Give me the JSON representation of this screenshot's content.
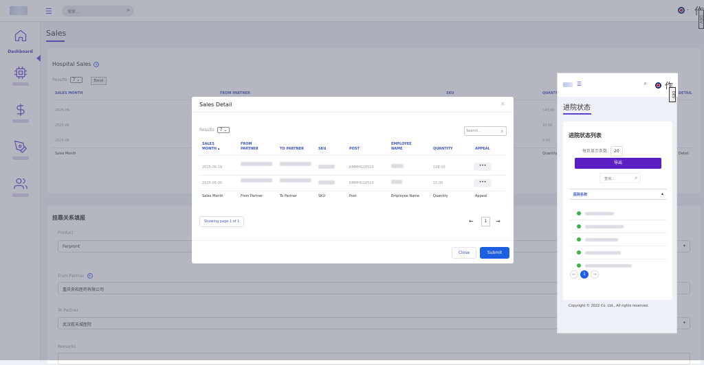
{
  "header": {
    "search_placeholder": "搜索...",
    "lang_char": "作",
    "badge": "DEV"
  },
  "sidebar": {
    "items": [
      {
        "label": "Dashboard",
        "icon": "home-icon"
      },
      {
        "label": "",
        "icon": "cpu-icon"
      },
      {
        "label": "",
        "icon": "dollar-icon"
      },
      {
        "label": "",
        "icon": "pen-tool-icon"
      },
      {
        "label": "",
        "icon": "users-icon"
      }
    ]
  },
  "page": {
    "title": "Sales"
  },
  "hospital_sales": {
    "title": "Hospital Sales",
    "results_label": "Results",
    "per_page": "7",
    "excel": "Excel",
    "headers": [
      "SALES MONTH",
      "FROM PARTNER",
      "SKU",
      "QUANTITY",
      "DETAIL"
    ],
    "rows": [
      {
        "month": "2025-06",
        "qty": "143.00"
      },
      {
        "month": "2025-06",
        "qty": "10.00"
      },
      {
        "month": "2025-06",
        "qty": "6.00"
      }
    ],
    "footer": [
      "Sales Month",
      "Quantity",
      "Detail"
    ]
  },
  "relation_form": {
    "title": "挂靠关系填报",
    "product_label": "Product",
    "product_value": "Ferpront",
    "from_label": "From Partner",
    "from_value": "重庆央和医药有限公司",
    "to_label": "To Partner",
    "to_value": "武汉航天城医院",
    "remarks_label": "Remarks"
  },
  "modal": {
    "title": "Sales Detail",
    "results_label": "Results",
    "per_page": "7",
    "search_placeholder": "Search...",
    "headers": [
      "SALES MONTH",
      "FROM PARTNER",
      "TO PARTNER",
      "SKU",
      "POST",
      "EMPLOYEE NAME",
      "QUANTITY",
      "APPEAL"
    ],
    "rows": [
      {
        "month": "2025-06-19",
        "post": "RMMHG10510",
        "qty": "128.00",
        "more": "•••"
      },
      {
        "month": "2025-06-30",
        "post": "RMMHG10510",
        "qty": "15.00",
        "more": "•••"
      }
    ],
    "footer": [
      "Sales Month",
      "From Partner",
      "To Partner",
      "SKU",
      "Post",
      "Employee Name",
      "Quantity",
      "Appeal"
    ],
    "showing": "Showing page 1 of 1",
    "page": "1",
    "close": "Close",
    "submit": "Submit"
  },
  "panel": {
    "title": "进院状态",
    "card_title": "进院状态列表",
    "per_page_label": "每页显示条数:",
    "per_page": "20",
    "export": "导出",
    "search": "查询...",
    "column": "医院名称",
    "page": "1",
    "copyright": "Copyright © 2022 Co. Ltd., All rights reserved.",
    "lang_char": "作",
    "badge": "DEV"
  },
  "colors": {
    "accent": "#5b3fcf",
    "submit": "#1c5fe0",
    "export": "#5a1fc2",
    "status": "#38b449"
  }
}
